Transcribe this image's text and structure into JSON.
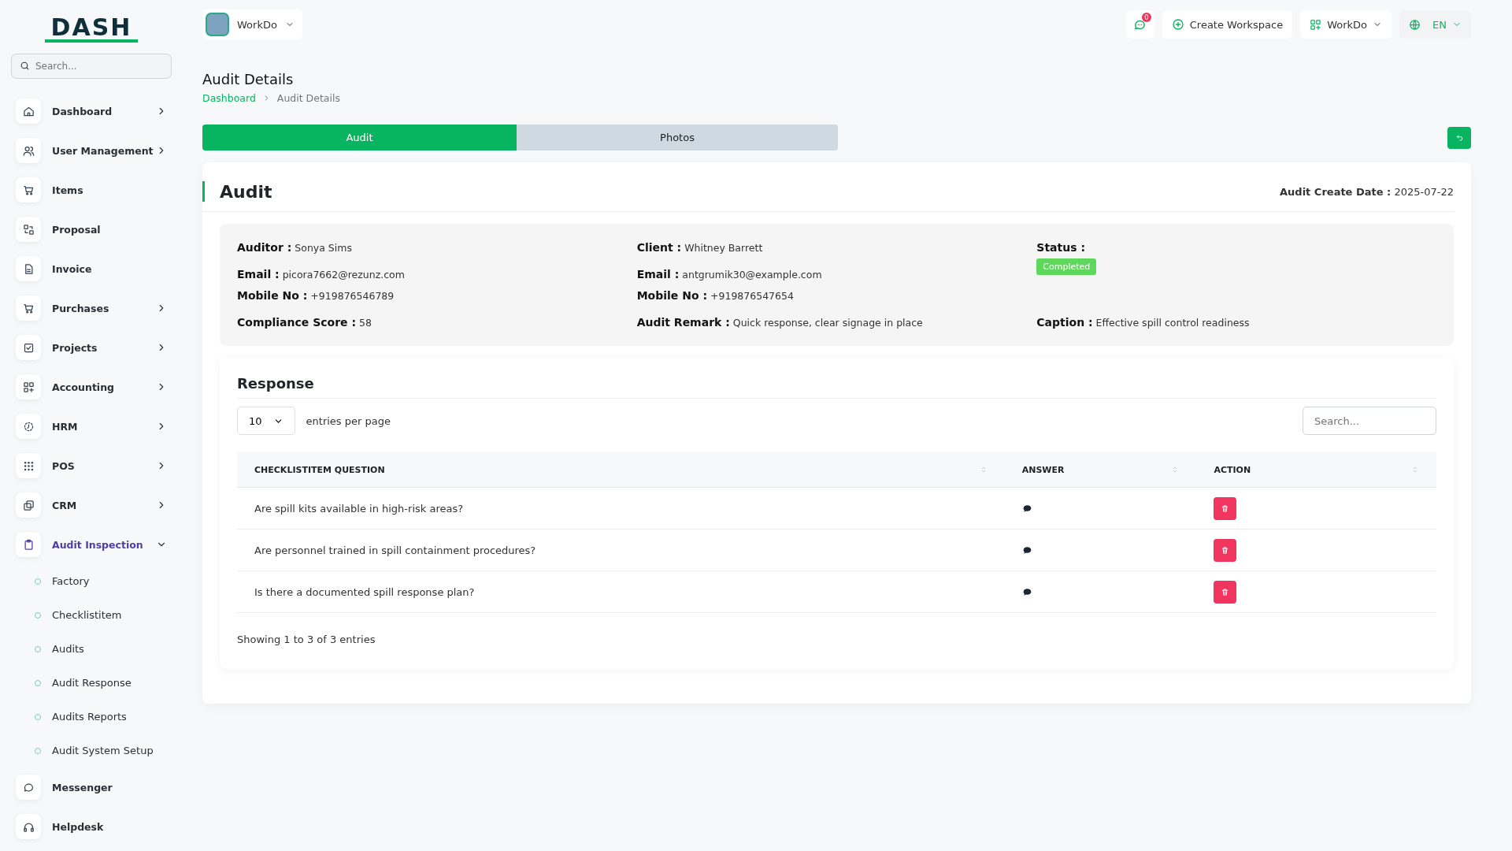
{
  "logo": {
    "text": "DASH"
  },
  "sidebar": {
    "search": {
      "placeholder": "Search..."
    },
    "items": [
      {
        "label": "Dashboard",
        "has_submenu": true,
        "expanded": false,
        "selected": false
      },
      {
        "label": "User Management",
        "has_submenu": true,
        "expanded": false,
        "selected": false
      },
      {
        "label": "Items",
        "has_submenu": false,
        "selected": false
      },
      {
        "label": "Proposal",
        "has_submenu": false,
        "selected": false
      },
      {
        "label": "Invoice",
        "has_submenu": false,
        "selected": false
      },
      {
        "label": "Purchases",
        "has_submenu": true,
        "expanded": false,
        "selected": false
      },
      {
        "label": "Projects",
        "has_submenu": true,
        "expanded": false,
        "selected": false
      },
      {
        "label": "Accounting",
        "has_submenu": true,
        "expanded": false,
        "selected": false
      },
      {
        "label": "HRM",
        "has_submenu": true,
        "expanded": false,
        "selected": false
      },
      {
        "label": "POS",
        "has_submenu": true,
        "expanded": false,
        "selected": false
      },
      {
        "label": "CRM",
        "has_submenu": true,
        "expanded": false,
        "selected": false
      },
      {
        "label": "Audit Inspection",
        "has_submenu": true,
        "expanded": true,
        "selected": true,
        "children": [
          {
            "label": "Factory"
          },
          {
            "label": "Checklistitem"
          },
          {
            "label": "Audits"
          },
          {
            "label": "Audit Response"
          },
          {
            "label": "Audits Reports"
          },
          {
            "label": "Audit System Setup"
          }
        ]
      },
      {
        "label": "Messenger",
        "has_submenu": false,
        "selected": false
      },
      {
        "label": "Helpdesk",
        "has_submenu": false,
        "selected": false
      }
    ]
  },
  "topbar": {
    "workspace": "WorkDo",
    "notification_count": "0",
    "create_workspace": "Create Workspace",
    "company": "WorkDo",
    "language": "EN"
  },
  "page": {
    "title": "Audit Details",
    "breadcrumb": [
      {
        "label": "Dashboard",
        "link": true
      },
      {
        "label": "Audit Details",
        "link": false
      }
    ]
  },
  "tabs": [
    {
      "label": "Audit",
      "selected": true
    },
    {
      "label": "Photos",
      "selected": false
    }
  ],
  "audit": {
    "title": "Audit",
    "create_date_label": "Audit Create Date :",
    "create_date": "2025-07-22",
    "columns": [
      [
        {
          "label": "Auditor :",
          "value": "Sonya Sims"
        },
        {
          "label": "Email :",
          "value": "picora7662@rezunz.com"
        },
        {
          "label": "Mobile No :",
          "value": "+919876546789"
        },
        {
          "label": "Compliance Score :",
          "value": "58"
        }
      ],
      [
        {
          "label": "Client :",
          "value": "Whitney Barrett"
        },
        {
          "label": "Email :",
          "value": "antgrumik30@example.com"
        },
        {
          "label": "Mobile No :",
          "value": "+919876547654"
        },
        {
          "label": "Audit Remark :",
          "value": "Quick response, clear signage in place"
        }
      ],
      [
        {
          "label": "Status :",
          "badge": "Completed"
        },
        {
          "label": "Caption :",
          "value": "Effective spill control readiness"
        }
      ]
    ]
  },
  "response": {
    "title": "Response",
    "page_size": "10",
    "page_size_label": "entries per page",
    "search_placeholder": "Search...",
    "columns": [
      "CHECKLISTITEM QUESTION",
      "ANSWER",
      "ACTION"
    ],
    "rows": [
      {
        "question": "Are spill kits available in high-risk areas?"
      },
      {
        "question": "Are personnel trained in spill containment procedures?"
      },
      {
        "question": "Is there a documented spill response plan?"
      }
    ],
    "footer": "Showing 1 to 3 of 3 entries"
  }
}
